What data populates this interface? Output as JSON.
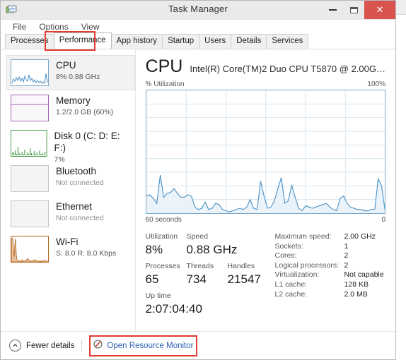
{
  "window": {
    "title": "Task Manager",
    "app_icon": "task-manager-icon",
    "minimize_label": "–",
    "maximize_label": "❐",
    "close_label": "✕",
    "close_color": "#d9534f"
  },
  "menu": {
    "items": [
      {
        "label": "File"
      },
      {
        "label": "Options"
      },
      {
        "label": "View"
      }
    ]
  },
  "tabs": {
    "items": [
      {
        "label": "Processes",
        "active": false
      },
      {
        "label": "Performance",
        "active": true
      },
      {
        "label": "App history",
        "active": false
      },
      {
        "label": "Startup",
        "active": false
      },
      {
        "label": "Users",
        "active": false
      },
      {
        "label": "Details",
        "active": false
      },
      {
        "label": "Services",
        "active": false
      }
    ],
    "highlight_color": "#e23b30"
  },
  "sidebar": {
    "items": [
      {
        "name": "cpu",
        "title": "CPU",
        "sub": "8%  0.88 GHz",
        "selected": true,
        "color": "#4a90c4",
        "muted": false
      },
      {
        "name": "memory",
        "title": "Memory",
        "sub": "1.2/2.0 GB (60%)",
        "selected": false,
        "color": "#a163b5",
        "muted": false
      },
      {
        "name": "disk",
        "title": "Disk 0 (C: D: E: F:)",
        "sub": "7%",
        "selected": false,
        "color": "#4a9b48",
        "muted": false
      },
      {
        "name": "bluetooth",
        "title": "Bluetooth",
        "sub": "Not connected",
        "selected": false,
        "color": "#b8b8b8",
        "muted": true
      },
      {
        "name": "ethernet",
        "title": "Ethernet",
        "sub": "Not connected",
        "selected": false,
        "color": "#b8b8b8",
        "muted": true
      },
      {
        "name": "wifi",
        "title": "Wi-Fi",
        "sub": "S: 8.0 R: 8.0 Kbps",
        "selected": false,
        "color": "#b5651d",
        "muted": false
      }
    ]
  },
  "main": {
    "title": "CPU",
    "subtitle": "Intel(R) Core(TM)2 Duo CPU T5870 @ 2.00G…",
    "stats_left": {
      "utilization_label": "Utilization",
      "utilization_value": "8%",
      "speed_label": "Speed",
      "speed_value": "0.88 GHz",
      "processes_label": "Processes",
      "processes_value": "65",
      "threads_label": "Threads",
      "threads_value": "734",
      "handles_label": "Handles",
      "handles_value": "21547",
      "uptime_label": "Up time",
      "uptime_value": "2:07:04:40"
    },
    "specs": [
      {
        "key": "Maximum speed:",
        "value": "2.00 GHz"
      },
      {
        "key": "Sockets:",
        "value": "1"
      },
      {
        "key": "Cores:",
        "value": "2"
      },
      {
        "key": "Logical processors:",
        "value": "2"
      },
      {
        "key": "Virtualization:",
        "value": "Not capable"
      },
      {
        "key": "L1 cache:",
        "value": "128 KB"
      },
      {
        "key": "L2 cache:",
        "value": "2.0 MB"
      }
    ]
  },
  "footer": {
    "fewer_details_label": "Fewer details",
    "fewer_details_icon": "chevron-up-circle-icon",
    "open_resource_monitor_label": "Open Resource Monitor",
    "open_resource_monitor_icon": "resource-monitor-icon",
    "highlight_color": "#e23b30"
  },
  "chart_data": {
    "type": "area",
    "title": "CPU % Utilization",
    "ylabel": "% Utilization",
    "ylabel_right": "100%",
    "xlabel": "60 seconds",
    "xlabel_right": "0",
    "ylim": [
      0,
      100
    ],
    "xlim": [
      60,
      0
    ],
    "grid": true,
    "grid_rows": 9,
    "grid_cols": 6,
    "line_color": "#4a90c4",
    "fill_color": "#eaf3fa",
    "x": [
      0,
      1,
      2,
      3,
      4,
      5,
      6,
      7,
      8,
      9,
      10,
      11,
      12,
      13,
      14,
      15,
      16,
      17,
      18,
      19,
      20,
      21,
      22,
      23,
      24,
      25,
      26,
      27,
      28,
      29,
      30,
      31,
      32,
      33,
      34,
      35,
      36,
      37,
      38,
      39,
      40,
      41,
      42,
      43,
      44,
      45,
      46,
      47,
      48,
      49,
      50,
      51,
      52,
      53,
      54,
      55,
      56,
      57,
      58,
      59,
      60
    ],
    "values": [
      14,
      15,
      12,
      8,
      31,
      13,
      16,
      17,
      20,
      16,
      13,
      13,
      15,
      14,
      5,
      3,
      4,
      9,
      3,
      4,
      8,
      7,
      3,
      2,
      1,
      2,
      3,
      4,
      3,
      5,
      11,
      4,
      3,
      26,
      14,
      4,
      5,
      10,
      20,
      29,
      8,
      10,
      23,
      13,
      4,
      2,
      6,
      5,
      4,
      5,
      6,
      7,
      8,
      5,
      3,
      2,
      12,
      14,
      8,
      5,
      4,
      3,
      3,
      2,
      2,
      3,
      3,
      28,
      22,
      2
    ]
  }
}
